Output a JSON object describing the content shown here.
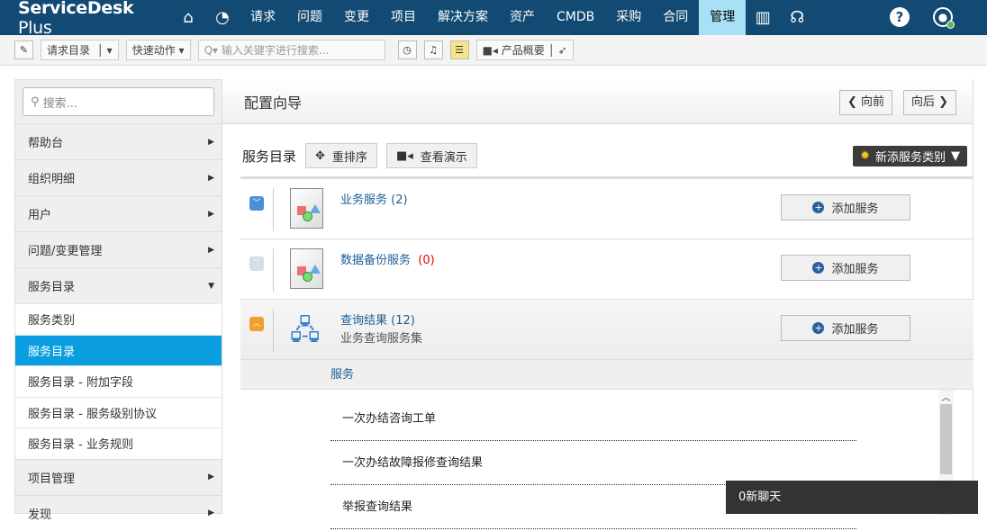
{
  "nav": {
    "logo_main": "ServiceDesk",
    "logo_sub": "Plus",
    "items": [
      "请求",
      "问题",
      "变更",
      "项目",
      "解决方案",
      "资产",
      "CMDB",
      "采购",
      "合同",
      "管理"
    ],
    "active": "管理",
    "help": "?"
  },
  "toolbar": {
    "request_catalog": "请求目录",
    "quick_actions": "快速动作",
    "search_placeholder": "输入关键字进行搜索...",
    "product_overview": "产品概要"
  },
  "sidebar": {
    "search_placeholder": "搜索...",
    "items": [
      "帮助台",
      "组织明细",
      "用户",
      "问题/变更管理",
      "服务目录"
    ],
    "subitems": [
      "服务类别",
      "服务目录",
      "服务目录 - 附加字段",
      "服务目录 - 服务级别协议",
      "服务目录 - 业务规则"
    ],
    "after": [
      "项目管理",
      "发现"
    ]
  },
  "main": {
    "title": "配置向导",
    "prev": "向前",
    "next": "向后",
    "section": "服务目录",
    "reorder": "重排序",
    "demo": "查看演示",
    "add_category": "新添服务类别",
    "categories": [
      {
        "name": "业务服务",
        "count": "(2)",
        "desc": ""
      },
      {
        "name": "数据备份服务",
        "count": "(0)",
        "desc": ""
      },
      {
        "name": "查询结果",
        "count": "(12)",
        "desc": "业务查询服务集"
      }
    ],
    "add_service": "添加服务",
    "services_header": "服务",
    "services": [
      "一次办结咨询工单",
      "一次办结故障报修查询结果",
      "举报查询结果"
    ]
  },
  "chat": "0新聊天"
}
